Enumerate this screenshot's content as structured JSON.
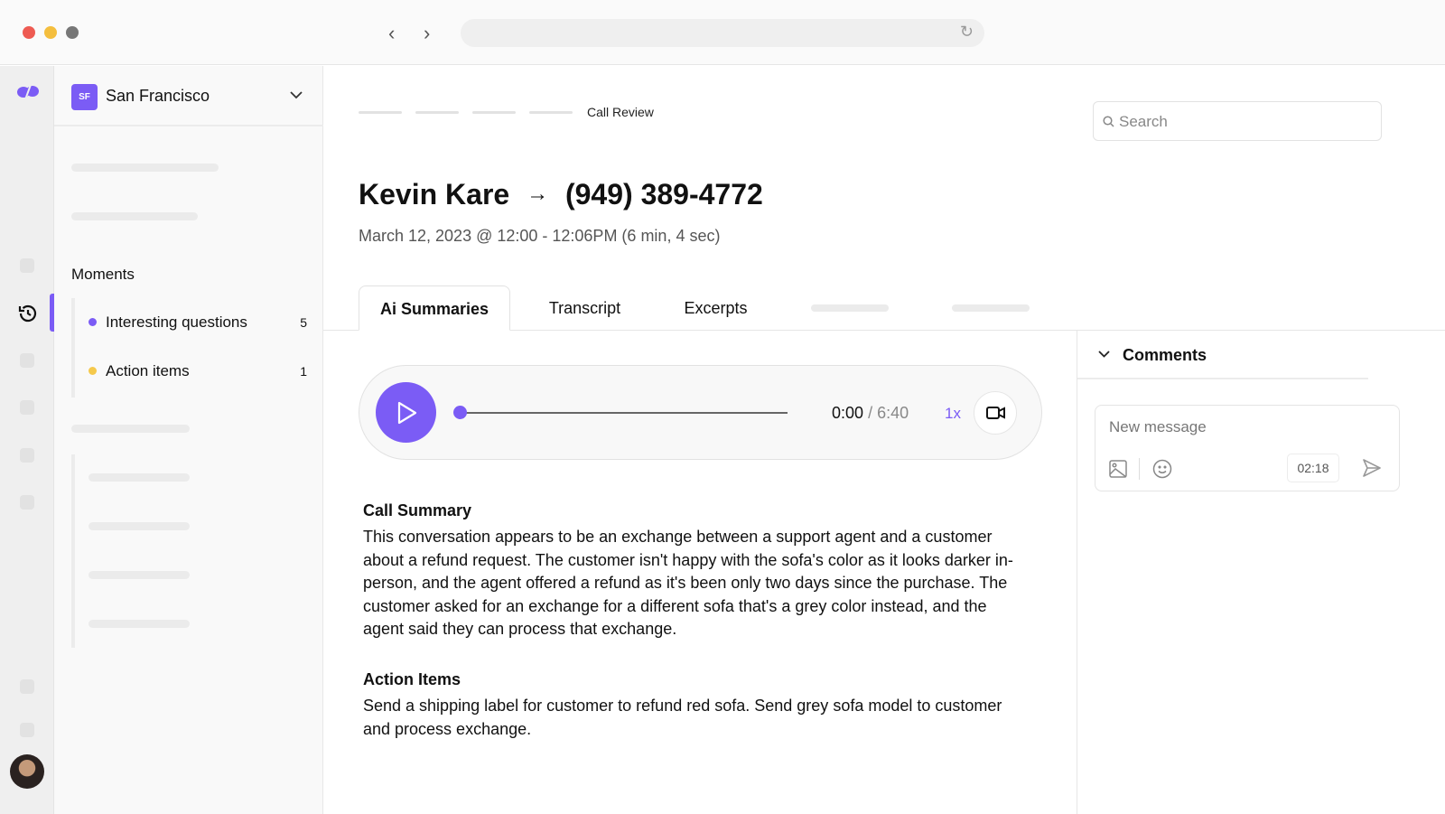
{
  "workspace": {
    "initials": "SF",
    "name": "San Francisco"
  },
  "moments": {
    "title": "Moments",
    "items": [
      {
        "label": "Interesting questions",
        "count": "5",
        "color": "#7b5cf5"
      },
      {
        "label": "Action items",
        "count": "1",
        "color": "#f5c94c"
      }
    ]
  },
  "breadcrumb": {
    "current": "Call Review"
  },
  "search": {
    "placeholder": "Search"
  },
  "call": {
    "from": "Kevin Kare",
    "to": "(949) 389-4772",
    "meta": "March 12, 2023 @ 12:00 - 12:06PM (6 min, 4 sec)"
  },
  "tabs": [
    "Ai Summaries",
    "Transcript",
    "Excerpts"
  ],
  "player": {
    "current": "0:00",
    "total": "/ 6:40",
    "speed": "1x",
    "progress": 0
  },
  "summary": {
    "title": "Call Summary",
    "body": "This conversation appears to be an exchange between a support agent and a customer about a refund request. The customer isn't happy with the sofa's color as it looks darker in-person, and the agent offered a refund as it's been only two days since the purchase. The customer asked for an exchange for a different sofa that's a grey color instead, and the agent said they can process that exchange."
  },
  "action_items": {
    "title": "Action Items",
    "body": "Send a shipping label for customer to refund red sofa. Send grey sofa model to customer and process exchange."
  },
  "comments": {
    "title": "Comments",
    "placeholder": "New message",
    "timestamp": "02:18"
  },
  "colors": {
    "accent": "#7b5cf5"
  }
}
